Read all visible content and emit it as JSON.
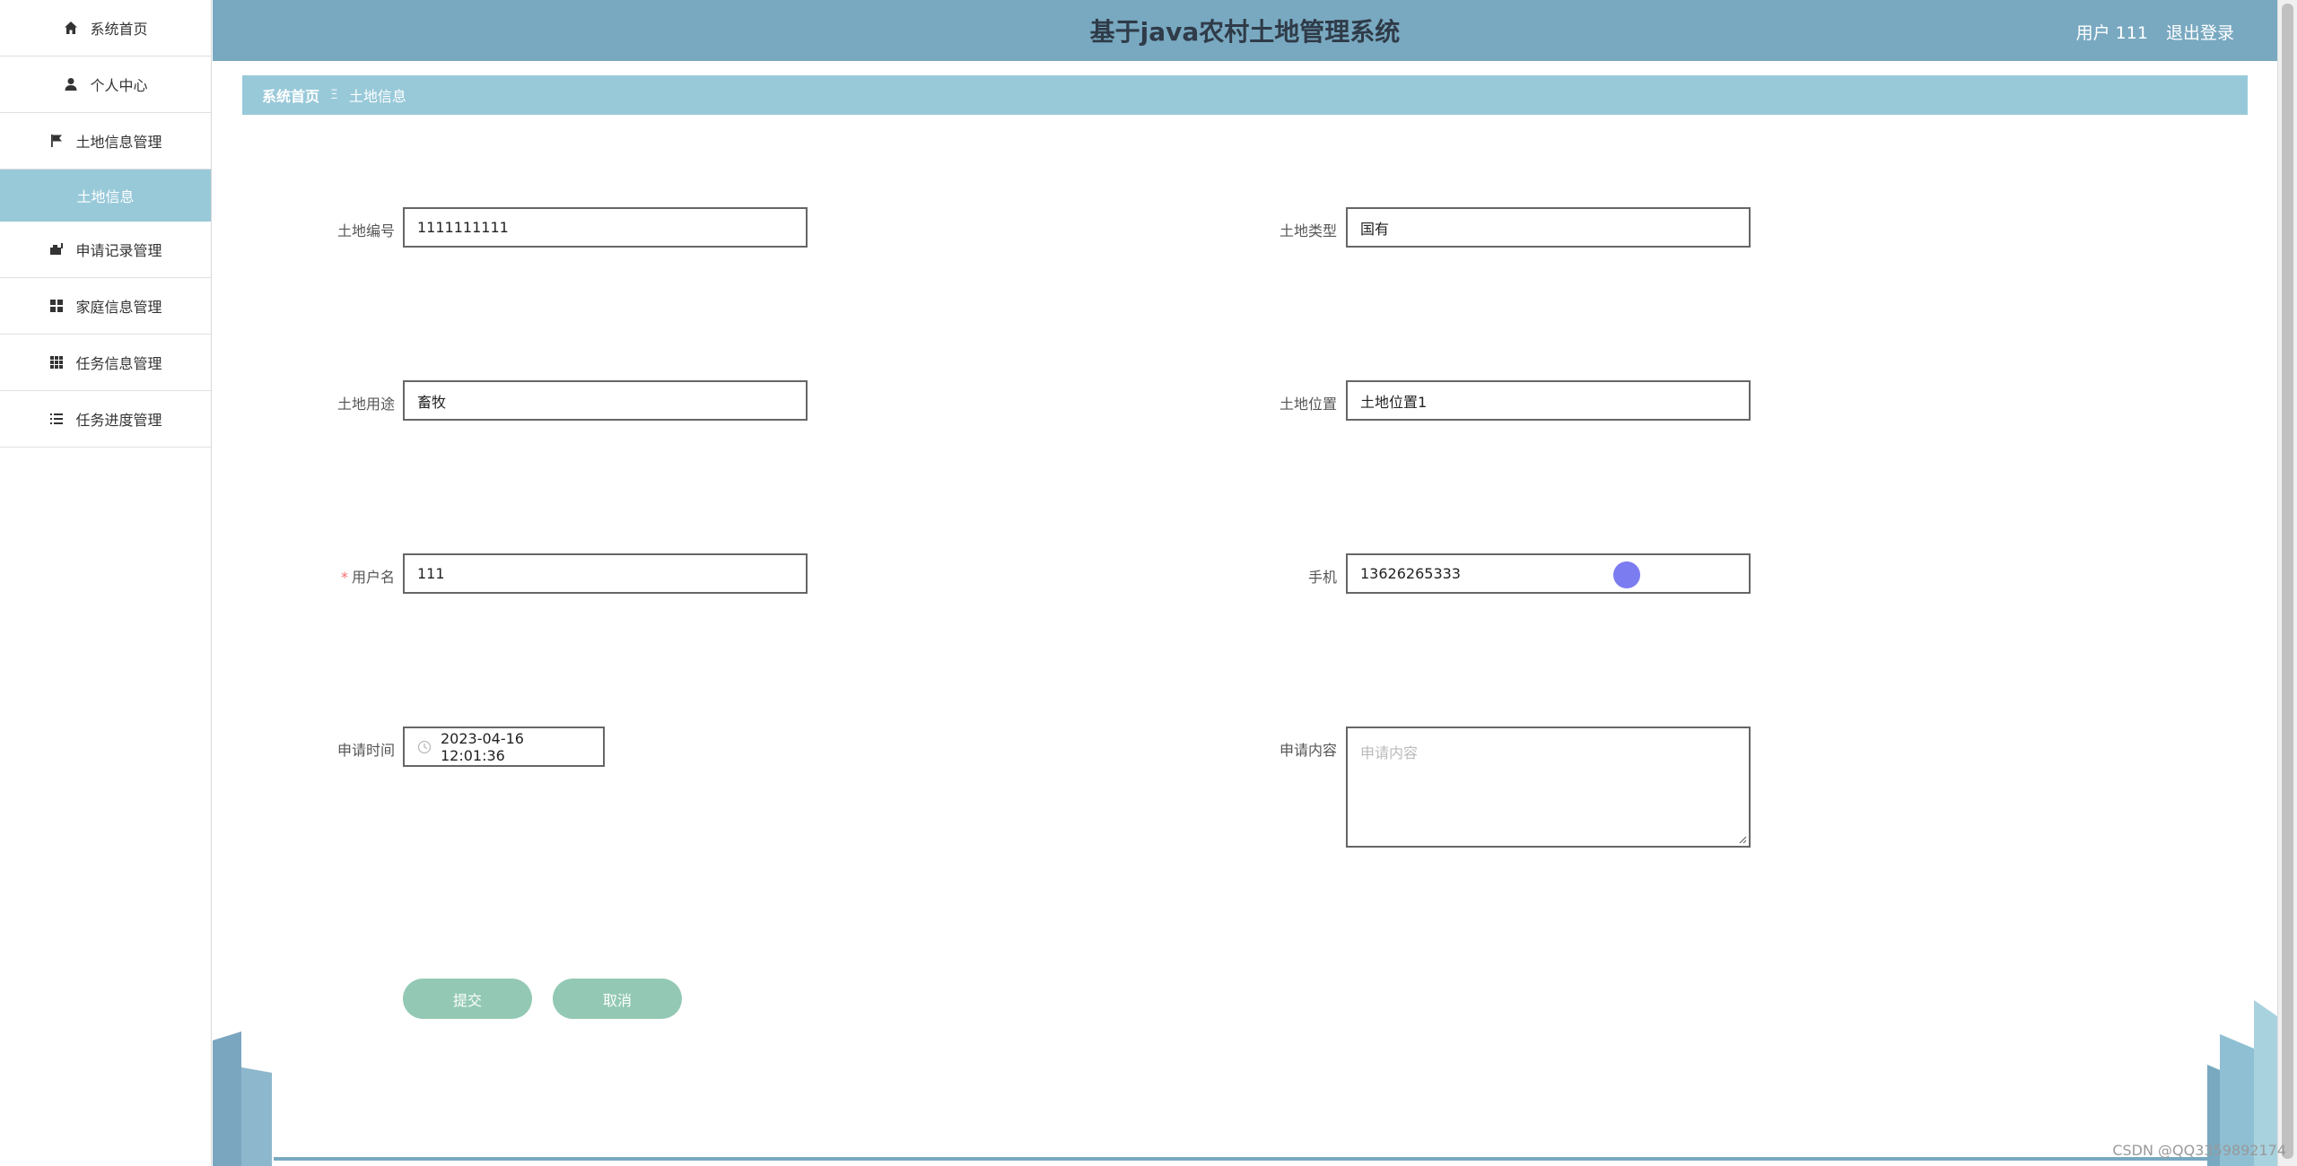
{
  "app": {
    "title": "基于java农村土地管理系统",
    "user_label": "用户 111",
    "logout_label": "退出登录"
  },
  "sidebar": {
    "items": [
      {
        "label": "系统首页",
        "icon": "home-icon"
      },
      {
        "label": "个人中心",
        "icon": "user-icon"
      },
      {
        "label": "土地信息管理",
        "icon": "flag-icon"
      },
      {
        "label": "土地信息",
        "icon": ""
      },
      {
        "label": "申请记录管理",
        "icon": "briefcase-icon"
      },
      {
        "label": "家庭信息管理",
        "icon": "grid-icon"
      },
      {
        "label": "任务信息管理",
        "icon": "apps-icon"
      },
      {
        "label": "任务进度管理",
        "icon": "list-icon"
      }
    ]
  },
  "breadcrumb": {
    "home": "系统首页",
    "separator": "Ξ",
    "current": "土地信息"
  },
  "form": {
    "land_no_label": "土地编号",
    "land_no_value": "1111111111",
    "land_type_label": "土地类型",
    "land_type_value": "国有",
    "land_use_label": "土地用途",
    "land_use_value": "畜牧",
    "land_location_label": "土地位置",
    "land_location_value": "土地位置1",
    "username_required": "*",
    "username_label": "用户名",
    "username_value": "111",
    "phone_label": "手机",
    "phone_value": "13626265333",
    "apply_time_label": "申请时间",
    "apply_time_value": "2023-04-16 12:01:36",
    "apply_content_label": "申请内容",
    "apply_content_placeholder": "申请内容",
    "submit_label": "提交",
    "cancel_label": "取消"
  },
  "watermark": "CSDN @QQ3359892174",
  "colors": {
    "header": "#79a9c1",
    "breadcrumb": "#98c9d9",
    "active_sidebar": "#98c9d9",
    "button": "#93c9b4",
    "title_text": "#2f3b48"
  }
}
